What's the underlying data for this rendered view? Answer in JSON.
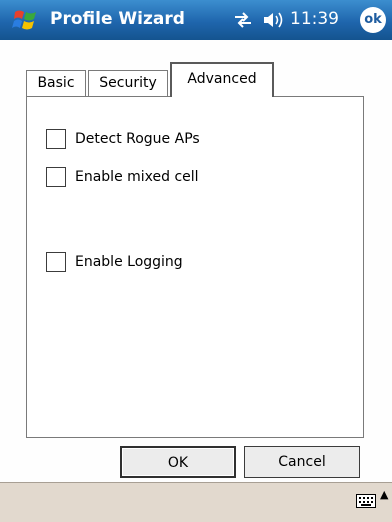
{
  "title_bar": {
    "app_name": "Profile Wizard",
    "time": "11:39",
    "ok_label": "ok",
    "icons": [
      "windows-start-icon",
      "connectivity-icon",
      "volume-icon",
      "ok-icon"
    ]
  },
  "tabs": [
    {
      "label": "Basic",
      "selected": false
    },
    {
      "label": "Security",
      "selected": false
    },
    {
      "label": "Advanced",
      "selected": true
    }
  ],
  "options": [
    {
      "label": "Detect Rogue APs",
      "checked": false
    },
    {
      "label": "Enable mixed cell",
      "checked": false
    },
    {
      "label": "Enable Logging",
      "checked": false
    }
  ],
  "buttons": {
    "ok": "OK",
    "cancel": "Cancel"
  },
  "taskbar": {
    "icons": [
      "keyboard-icon",
      "input-menu-arrow-icon"
    ]
  },
  "colors": {
    "title_bar": "#1f66ad",
    "taskbar": "#e2d9ce",
    "panel_border": "#7a7a7a"
  }
}
